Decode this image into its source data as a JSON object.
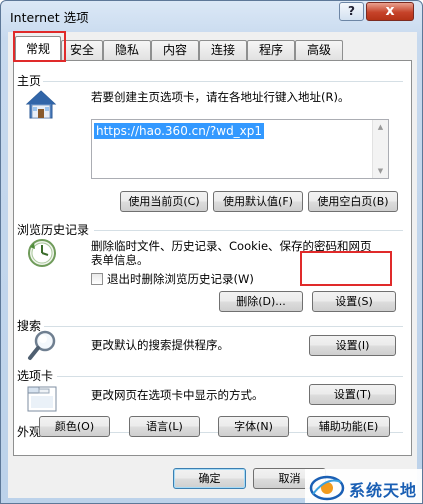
{
  "window": {
    "title": "Internet 选项",
    "help_glyph": "?",
    "close_glyph": "x"
  },
  "tabs": [
    {
      "label": "常规",
      "active": true
    },
    {
      "label": "安全"
    },
    {
      "label": "隐私"
    },
    {
      "label": "内容"
    },
    {
      "label": "连接"
    },
    {
      "label": "程序"
    },
    {
      "label": "高级"
    }
  ],
  "homepage": {
    "section_title": "主页",
    "description": "若要创建主页选项卡，请在各地址行键入地址(R)。",
    "url": "https://hao.360.cn/?wd_xp1",
    "buttons": {
      "use_current": "使用当前页(C)",
      "use_default": "使用默认值(F)",
      "use_blank": "使用空白页(B)"
    }
  },
  "history": {
    "section_title": "浏览历史记录",
    "description_line1": "删除临时文件、历史记录、Cookie、保存的密码和网页",
    "description_line2": "表单信息。",
    "checkbox_label": "退出时删除浏览历史记录(W)",
    "checkbox_checked": false,
    "buttons": {
      "delete": "删除(D)...",
      "settings": "设置(S)"
    }
  },
  "search": {
    "section_title": "搜索",
    "description": "更改默认的搜索提供程序。",
    "button": "设置(I)"
  },
  "tabs_section": {
    "section_title": "选项卡",
    "description": "更改网页在选项卡中显示的方式。",
    "button": "设置(T)"
  },
  "appearance": {
    "section_title": "外观",
    "buttons": {
      "colors": "颜色(O)",
      "languages": "语言(L)",
      "fonts": "字体(N)",
      "accessibility": "辅助功能(E)"
    }
  },
  "dialog_buttons": {
    "ok": "确定",
    "cancel": "取消"
  },
  "watermark": {
    "text": "系统天地"
  },
  "colors": {
    "highlight_red": "#e02a2a",
    "selection_blue": "#3399ff",
    "watermark_blue": "#1a5fb4"
  }
}
